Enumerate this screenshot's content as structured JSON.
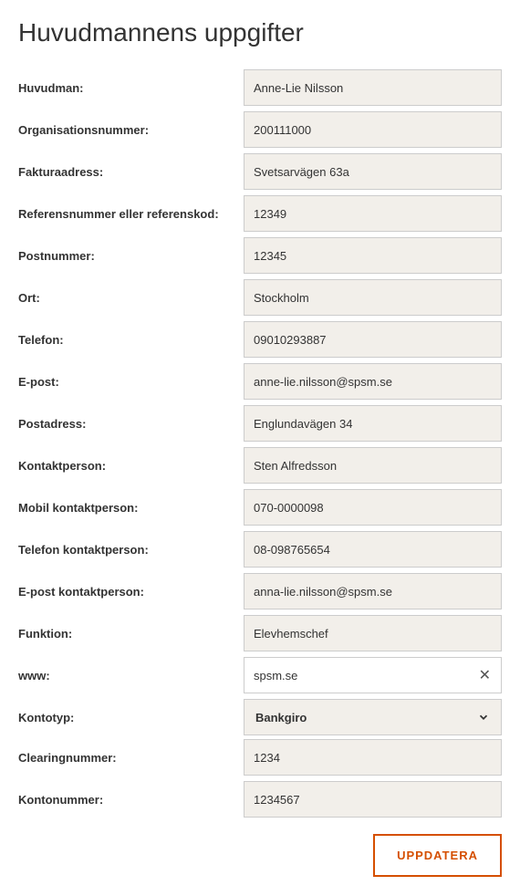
{
  "title": "Huvudmannens uppgifter",
  "fields": {
    "huvudman": {
      "label": "Huvudman:",
      "value": "Anne-Lie Nilsson"
    },
    "orgnr": {
      "label": "Organisationsnummer:",
      "value": "200111000"
    },
    "fakturaadress": {
      "label": "Fakturaadress:",
      "value": "Svetsarvägen 63a"
    },
    "refnr": {
      "label": "Referensnummer eller referenskod:",
      "value": "12349"
    },
    "postnummer": {
      "label": "Postnummer:",
      "value": "12345"
    },
    "ort": {
      "label": "Ort:",
      "value": "Stockholm"
    },
    "telefon": {
      "label": "Telefon:",
      "value": "09010293887"
    },
    "epost": {
      "label": "E-post:",
      "value": "anne-lie.nilsson@spsm.se"
    },
    "postadress": {
      "label": "Postadress:",
      "value": "Englundavägen 34"
    },
    "kontaktperson": {
      "label": "Kontaktperson:",
      "value": "Sten Alfredsson"
    },
    "mobil_kontakt": {
      "label": "Mobil kontaktperson:",
      "value": "070-0000098"
    },
    "telefon_kontakt": {
      "label": "Telefon kontaktperson:",
      "value": "08-098765654"
    },
    "epost_kontakt": {
      "label": "E-post kontaktperson:",
      "value": "anna-lie.nilsson@spsm.se"
    },
    "funktion": {
      "label": "Funktion:",
      "value": "Elevhemschef"
    },
    "www": {
      "label": "www:",
      "value": "spsm.se"
    },
    "kontotyp": {
      "label": "Kontotyp:",
      "value": "Bankgiro"
    },
    "clearing": {
      "label": "Clearingnummer:",
      "value": "1234"
    },
    "kontonr": {
      "label": "Kontonummer:",
      "value": "1234567"
    }
  },
  "buttons": {
    "update": "UPPDATERA"
  }
}
